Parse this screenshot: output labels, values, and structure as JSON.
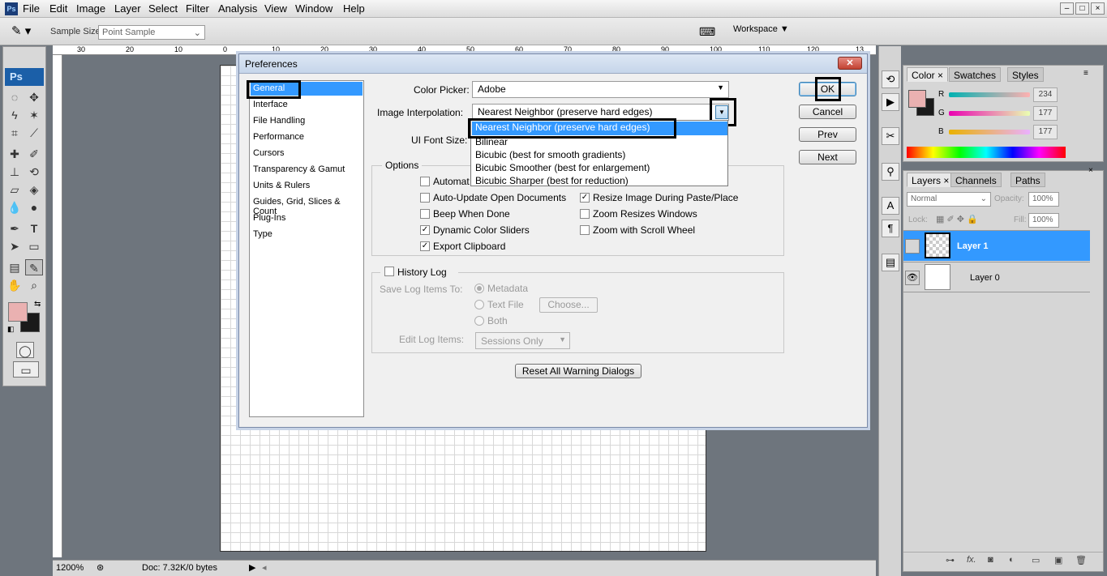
{
  "app": {
    "logo": "Ps",
    "menu": [
      "File",
      "Edit",
      "Image",
      "Layer",
      "Select",
      "Filter",
      "Analysis",
      "View",
      "Window",
      "Help"
    ],
    "window_controls": [
      "–",
      "□",
      "×"
    ]
  },
  "options_bar": {
    "sample_size_label": "Sample Size:",
    "sample_size_value": "Point Sample",
    "workspace_label": "Workspace"
  },
  "tools": {
    "ps_label": "Ps"
  },
  "ruler": {
    "h_ticks": [
      "30",
      "20",
      "10",
      "0",
      "10",
      "20",
      "30",
      "40",
      "50",
      "60",
      "70",
      "80",
      "90",
      "100",
      "110",
      "120",
      "13"
    ]
  },
  "status": {
    "zoom": "1200%",
    "doc": "Doc: 7.32K/0 bytes"
  },
  "color_panel": {
    "tabs": [
      "Color",
      "Swatches",
      "Styles"
    ],
    "r_label": "R",
    "g_label": "G",
    "b_label": "B",
    "r": "234",
    "g": "177",
    "b": "177",
    "fg_color": "#eab1b1",
    "bg_color": "#1a1a1a"
  },
  "layers_panel": {
    "tabs": [
      "Layers",
      "Channels",
      "Paths"
    ],
    "blend_mode": "Normal",
    "opacity_label": "Opacity:",
    "opacity": "100%",
    "lock_label": "Lock:",
    "fill_label": "Fill:",
    "fill": "100%",
    "layers": [
      {
        "name": "Layer 1",
        "selected": true,
        "visible": false
      },
      {
        "name": "Layer 0",
        "selected": false,
        "visible": true
      }
    ]
  },
  "dialog": {
    "title": "Preferences",
    "nav_items": [
      "General",
      "Interface",
      "File Handling",
      "Performance",
      "Cursors",
      "Transparency & Gamut",
      "Units & Rulers",
      "Guides, Grid, Slices & Count",
      "Plug-Ins",
      "Type"
    ],
    "selected_nav": "General",
    "buttons": {
      "ok": "OK",
      "cancel": "Cancel",
      "prev": "Prev",
      "next": "Next"
    },
    "color_picker_label": "Color Picker:",
    "color_picker_value": "Adobe",
    "interpolation_label": "Image Interpolation:",
    "interpolation_value": "Nearest Neighbor (preserve hard edges)",
    "interpolation_options": [
      "Nearest Neighbor (preserve hard edges)",
      "Bilinear",
      "Bicubic (best for smooth gradients)",
      "Bicubic Smoother (best for enlargement)",
      "Bicubic Sharper (best for reduction)"
    ],
    "ui_font_label": "UI Font Size:",
    "options_group": "Options",
    "options_left": [
      {
        "label": "Automat",
        "checked": false
      },
      {
        "label": "Auto-Update Open Documents",
        "checked": false
      },
      {
        "label": "Beep When Done",
        "checked": false
      },
      {
        "label": "Dynamic Color Sliders",
        "checked": true
      },
      {
        "label": "Export Clipboard",
        "checked": true
      }
    ],
    "options_right": [
      {
        "label": "Resize Image During Paste/Place",
        "checked": true
      },
      {
        "label": "Zoom Resizes Windows",
        "checked": false
      },
      {
        "label": "Zoom with Scroll Wheel",
        "checked": false
      }
    ],
    "history_log_label": "History Log",
    "save_log_label": "Save Log Items To:",
    "save_log_options": [
      "Metadata",
      "Text File",
      "Both"
    ],
    "choose_label": "Choose...",
    "edit_log_label": "Edit Log Items:",
    "edit_log_value": "Sessions Only",
    "reset_warnings": "Reset All Warning Dialogs"
  }
}
